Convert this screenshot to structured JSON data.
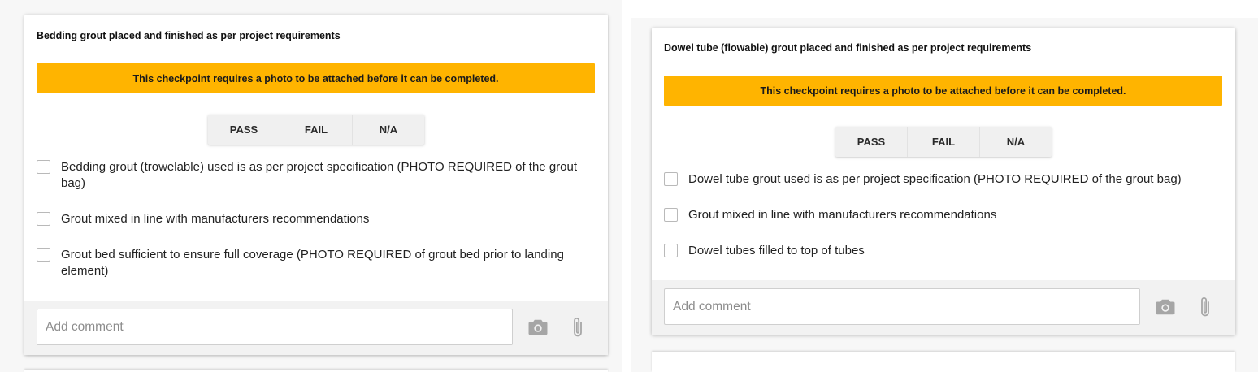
{
  "cards": [
    {
      "title": "Bedding grout placed and finished as per project requirements",
      "banner": "This checkpoint requires a photo to be attached before it can be completed.",
      "options": [
        "PASS",
        "FAIL",
        "N/A"
      ],
      "items": [
        "Bedding grout (trowelable) used is as per project specification (PHOTO REQUIRED of the grout bag)",
        "Grout mixed in line with manufacturers recommendations",
        "Grout bed sufficient to ensure full coverage (PHOTO REQUIRED of grout bed prior to landing element)"
      ],
      "comment_placeholder": "Add comment"
    },
    {
      "title": "Dowel tube (flowable) grout placed and finished as per project requirements",
      "banner": "This checkpoint requires a photo to be attached before it can be completed.",
      "options": [
        "PASS",
        "FAIL",
        "N/A"
      ],
      "items": [
        "Dowel tube grout used is as per project specification (PHOTO REQUIRED of the grout bag)",
        "Grout mixed in line with manufacturers recommendations",
        "Dowel tubes filled to top of tubes"
      ],
      "comment_placeholder": "Add comment"
    }
  ],
  "icons": {
    "photo": "camera-icon",
    "attach": "paperclip-icon"
  },
  "colors": {
    "banner": "#ffb400",
    "footer": "#f2f2f2",
    "icon": "#a6a6a6"
  }
}
